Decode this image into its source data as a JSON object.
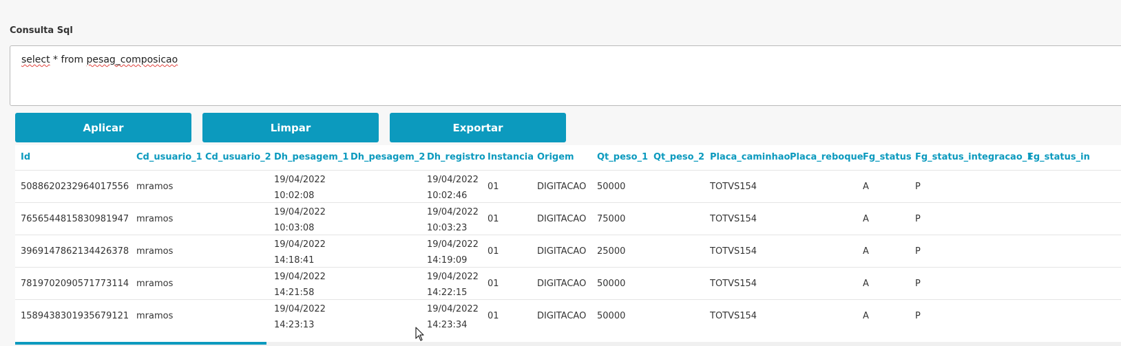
{
  "query": {
    "label": "Consulta Sql",
    "sql_word_1": "select",
    "sql_mid": " * from ",
    "sql_word_2": "pesag_composicao"
  },
  "buttons": {
    "apply": "Aplicar",
    "clear": "Limpar",
    "export": "Exportar"
  },
  "table": {
    "columns": [
      "Id",
      "Cd_usuario_1",
      "Cd_usuario_2",
      "Dh_pesagem_1",
      "Dh_pesagem_2",
      "Dh_registro",
      "Instancia",
      "Origem",
      "Qt_peso_1",
      "Qt_peso_2",
      "Placa_caminhao",
      "Placa_reboque",
      "Fg_status",
      "Fg_status_integracao_1",
      "Fg_status_in"
    ],
    "rows": [
      {
        "id": "5088620232964017556",
        "cd_usuario_1": "mramos",
        "cd_usuario_2": "",
        "dh_pesagem_1_date": "19/04/2022",
        "dh_pesagem_1_time": "10:02:08",
        "dh_pesagem_2": "",
        "dh_registro_date": "19/04/2022",
        "dh_registro_time": "10:02:46",
        "instancia": "01",
        "origem": "DIGITACAO",
        "qt_peso_1": "50000",
        "qt_peso_2": "",
        "placa_caminhao": "TOTVS154",
        "placa_reboque": "",
        "fg_status": "A",
        "fg_status_integracao_1": "P"
      },
      {
        "id": "7656544815830981947",
        "cd_usuario_1": "mramos",
        "cd_usuario_2": "",
        "dh_pesagem_1_date": "19/04/2022",
        "dh_pesagem_1_time": "10:03:08",
        "dh_pesagem_2": "",
        "dh_registro_date": "19/04/2022",
        "dh_registro_time": "10:03:23",
        "instancia": "01",
        "origem": "DIGITACAO",
        "qt_peso_1": "75000",
        "qt_peso_2": "",
        "placa_caminhao": "TOTVS154",
        "placa_reboque": "",
        "fg_status": "A",
        "fg_status_integracao_1": "P"
      },
      {
        "id": "3969147862134426378",
        "cd_usuario_1": "mramos",
        "cd_usuario_2": "",
        "dh_pesagem_1_date": "19/04/2022",
        "dh_pesagem_1_time": "14:18:41",
        "dh_pesagem_2": "",
        "dh_registro_date": "19/04/2022",
        "dh_registro_time": "14:19:09",
        "instancia": "01",
        "origem": "DIGITACAO",
        "qt_peso_1": "25000",
        "qt_peso_2": "",
        "placa_caminhao": "TOTVS154",
        "placa_reboque": "",
        "fg_status": "A",
        "fg_status_integracao_1": "P"
      },
      {
        "id": "7819702090571773114",
        "cd_usuario_1": "mramos",
        "cd_usuario_2": "",
        "dh_pesagem_1_date": "19/04/2022",
        "dh_pesagem_1_time": "14:21:58",
        "dh_pesagem_2": "",
        "dh_registro_date": "19/04/2022",
        "dh_registro_time": "14:22:15",
        "instancia": "01",
        "origem": "DIGITACAO",
        "qt_peso_1": "50000",
        "qt_peso_2": "",
        "placa_caminhao": "TOTVS154",
        "placa_reboque": "",
        "fg_status": "A",
        "fg_status_integracao_1": "P"
      },
      {
        "id": "1589438301935679121",
        "cd_usuario_1": "mramos",
        "cd_usuario_2": "",
        "dh_pesagem_1_date": "19/04/2022",
        "dh_pesagem_1_time": "14:23:13",
        "dh_pesagem_2": "",
        "dh_registro_date": "19/04/2022",
        "dh_registro_time": "14:23:34",
        "instancia": "01",
        "origem": "DIGITACAO",
        "qt_peso_1": "50000",
        "qt_peso_2": "",
        "placa_caminhao": "TOTVS154",
        "placa_reboque": "",
        "fg_status": "A",
        "fg_status_integracao_1": "P"
      }
    ]
  },
  "colors": {
    "accent": "#0c9abe",
    "text": "#333333",
    "background": "#f7f7f7"
  },
  "icons": {
    "cursor": "mouse-pointer-icon"
  }
}
